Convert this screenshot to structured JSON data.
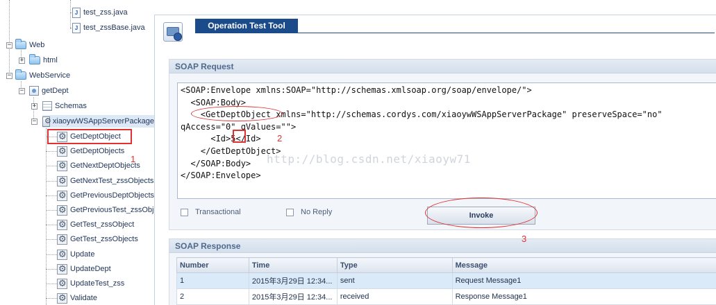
{
  "tree": {
    "items": [
      {
        "label": "test_zss.java",
        "icon": "java-file-icon"
      },
      {
        "label": "test_zssBase.java",
        "icon": "java-file-icon"
      },
      {
        "label": "Web",
        "icon": "folder-icon",
        "toggle": "−"
      },
      {
        "label": "html",
        "icon": "folder-icon",
        "toggle": "+"
      },
      {
        "label": "WebService",
        "icon": "folder-icon",
        "toggle": "−"
      },
      {
        "label": "getDept",
        "icon": "webservice-icon",
        "toggle": "−"
      },
      {
        "label": "Schemas",
        "icon": "schema-icon",
        "toggle": "+"
      },
      {
        "label": "xiaoywWSAppServerPackage",
        "icon": "package-icon",
        "toggle": "−"
      }
    ],
    "operations": [
      "GetDeptObject",
      "GetDeptObjects",
      "GetNextDeptObjects",
      "GetNextTest_zssObjects",
      "GetPreviousDeptObjects",
      "GetPreviousTest_zssObjects",
      "GetTest_zssObject",
      "GetTest_zssObjects",
      "Update",
      "UpdateDept",
      "UpdateTest_zss",
      "Validate"
    ],
    "java_badge": "J"
  },
  "tool": {
    "title": "Operation Test Tool"
  },
  "request": {
    "heading": "SOAP Request",
    "xml_lines": [
      "<SOAP:Envelope xmlns:SOAP=\"http://schemas.xmlsoap.org/soap/envelope/\">",
      "  <SOAP:Body>",
      "    <GetDeptObject xmlns=\"http://schemas.cordys.com/xiaoywWSAppServerPackage\" preserveSpace=\"no\"",
      "qAccess=\"0\" qValues=\"\">",
      "      <Id>5</Id>",
      "    </GetDeptObject>",
      "  </SOAP:Body>",
      "</SOAP:Envelope>"
    ],
    "transactional_label": "Transactional",
    "no_reply_label": "No Reply",
    "invoke_label": "Invoke"
  },
  "response": {
    "heading": "SOAP Response",
    "columns": [
      "Number",
      "Time",
      "Type",
      "Message"
    ],
    "rows": [
      {
        "number": "1",
        "time": "2015年3月29日  12:34...",
        "type": "sent",
        "message": "Request Message1"
      },
      {
        "number": "2",
        "time": "2015年3月29日  12:34...",
        "type": "received",
        "message": "Response Message1"
      }
    ]
  },
  "annotations": {
    "one": "1",
    "two": "2",
    "three": "3",
    "watermark": "http://blog.csdn.net/xiaoyw71"
  },
  "colors": {
    "annotation": "#e03030",
    "title_bar": "#1b4b8a",
    "selected_row": "#dbeaf9"
  }
}
